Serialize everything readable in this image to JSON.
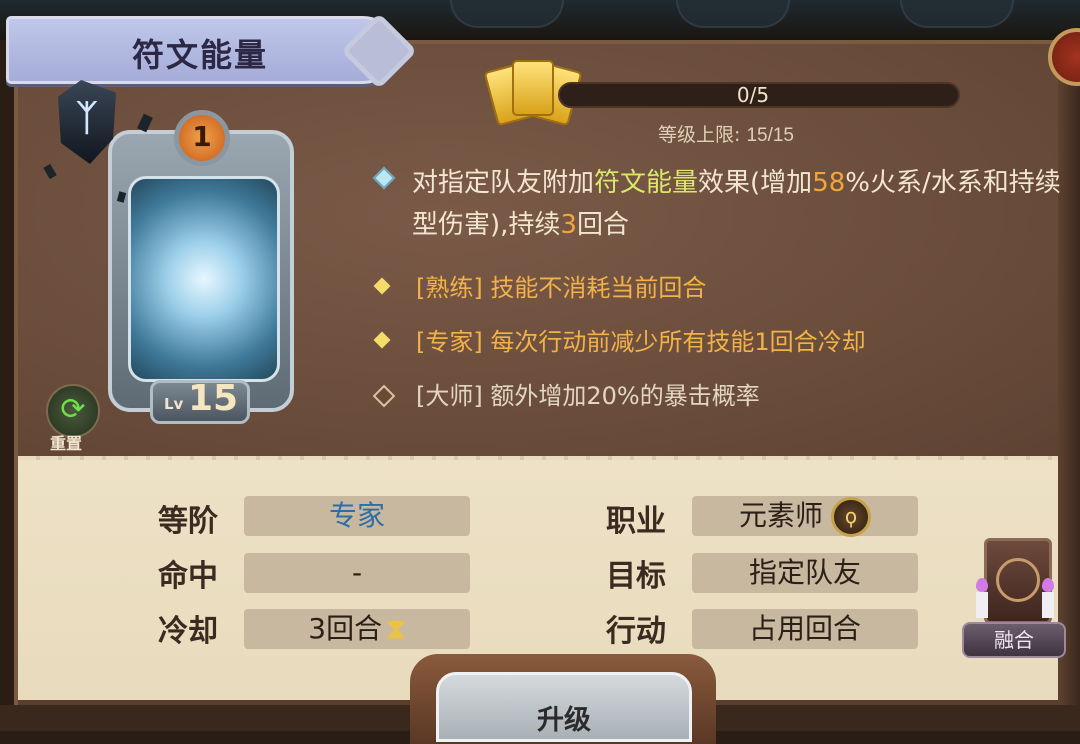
{
  "title": "符文能量",
  "skill": {
    "rank": "1",
    "level_prefix": "Lv",
    "level": "15",
    "icon": "rune-crystal-icon",
    "rune_glyph": "ᛉ"
  },
  "reset": {
    "label": "重置",
    "icon": "refresh-icon"
  },
  "progress": {
    "text": "0/5",
    "value": 0,
    "max": 5,
    "level_cap_label": "等级上限: ",
    "level_cap_value": "15/15"
  },
  "description": {
    "p1": "对指定队友附加",
    "hl1": "符文能量",
    "p2": "效果(增加",
    "hl2": "58",
    "p3": "%火系/水系和持续型伤害),持续",
    "hl3": "3",
    "p4": "回合"
  },
  "perks": [
    {
      "tag": "[熟练]",
      "text": "技能不消耗当前回合"
    },
    {
      "tag": "[专家]",
      "text": "每次行动前减少所有技能1回合冷却"
    },
    {
      "tag": "[大师]",
      "text": "额外增加20%的暴击概率"
    }
  ],
  "stats": {
    "rank_label": "等阶",
    "rank_value": "专家",
    "hit_label": "命中",
    "hit_value": "-",
    "cooldown_label": "冷却",
    "cooldown_value": "3回合",
    "cooldown_icon": "hourglass-icon",
    "cooldown_glyph": "⧗",
    "class_label": "职业",
    "class_value": "元素师",
    "class_icon": "elementalist-staff-icon",
    "class_glyph": "ϙ",
    "target_label": "目标",
    "target_value": "指定队友",
    "action_label": "行动",
    "action_value": "占用回合"
  },
  "fusion": {
    "label": "融合",
    "icon": "fusion-book-icon"
  },
  "upgrade": {
    "label": "升级"
  },
  "colors": {
    "highlight_green": "#d9e86a",
    "highlight_orange": "#f2a63a",
    "rank_blue": "#2a6fa8"
  }
}
